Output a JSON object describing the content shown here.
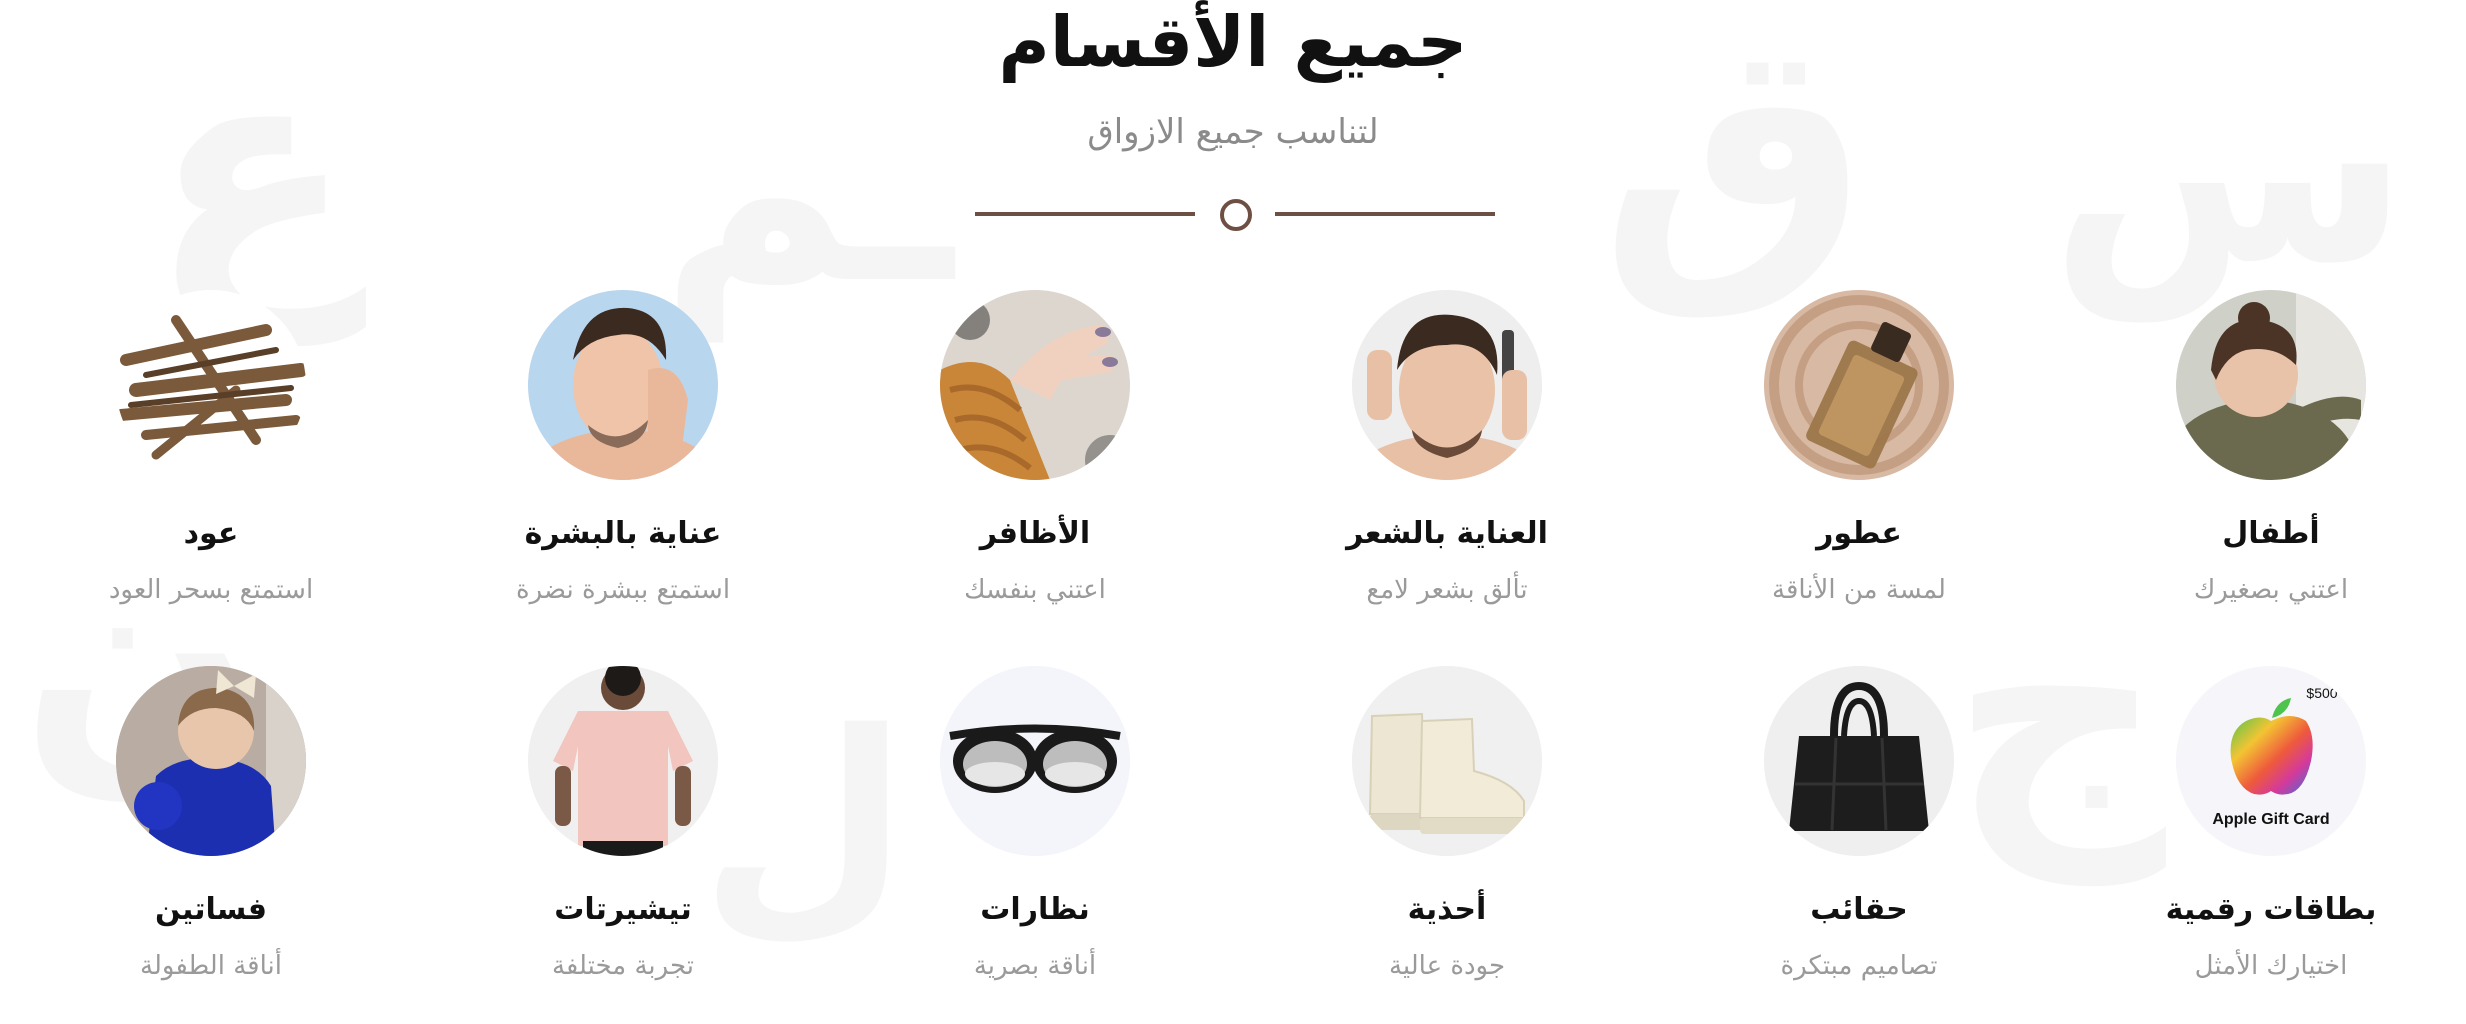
{
  "header": {
    "title": "جميع الأقسام",
    "subtitle": "لتناسب جميع الازواق"
  },
  "categories": [
    {
      "name": "أطفال",
      "description": "اعتني بصغيرك",
      "icon": "child-photo"
    },
    {
      "name": "عطور",
      "description": "لمسة من الأناقة",
      "icon": "perfume-bottle-photo"
    },
    {
      "name": "العناية بالشعر",
      "description": "تألق بشعر لامع",
      "icon": "man-combing-hair-photo"
    },
    {
      "name": "الأظافر",
      "description": "اعتني بنفسك",
      "icon": "painted-nails-photo"
    },
    {
      "name": "عناية بالبشرة",
      "description": "استمتع ببشرة نضرة",
      "icon": "man-skincare-photo"
    },
    {
      "name": "عود",
      "description": "استمتع بسحر العود",
      "icon": "oud-wood-photo"
    },
    {
      "name": "بطاقات رقمية",
      "description": "اختيارك الأمثل",
      "icon": "apple-gift-card-photo",
      "card_text": "Apple Gift Card",
      "card_amount": "$500"
    },
    {
      "name": "حقائب",
      "description": "تصاميم مبتكرة",
      "icon": "black-bag-photo"
    },
    {
      "name": "أحذية",
      "description": "جودة عالية",
      "icon": "cream-boots-photo"
    },
    {
      "name": "نظارات",
      "description": "أناقة بصرية",
      "icon": "sunglasses-photo"
    },
    {
      "name": "تيشيرتات",
      "description": "تجربة مختلفة",
      "icon": "pink-tshirt-photo"
    },
    {
      "name": "فساتين",
      "description": "أناقة الطفولة",
      "icon": "girl-blue-dress-photo"
    }
  ],
  "colors": {
    "accent": "#6e4f44",
    "title": "#111111",
    "muted": "#9a9a9a"
  }
}
